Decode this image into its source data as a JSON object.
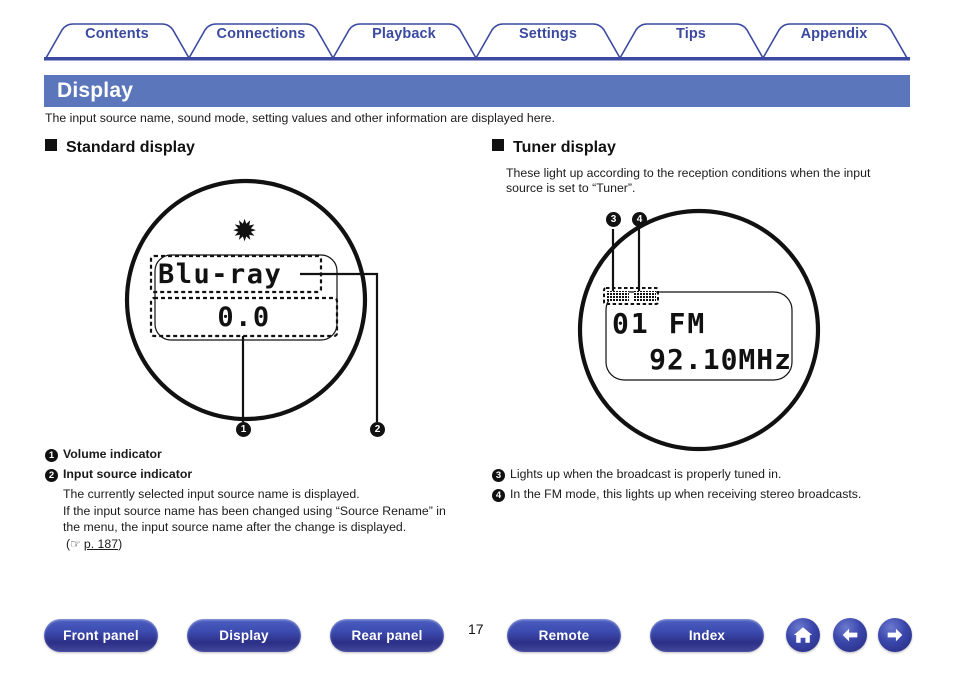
{
  "tabs": [
    {
      "label": "Contents",
      "name": "tab-contents"
    },
    {
      "label": "Connections",
      "name": "tab-connections"
    },
    {
      "label": "Playback",
      "name": "tab-playback"
    },
    {
      "label": "Settings",
      "name": "tab-settings"
    },
    {
      "label": "Tips",
      "name": "tab-tips"
    },
    {
      "label": "Appendix",
      "name": "tab-appendix"
    }
  ],
  "banner": {
    "title": "Display"
  },
  "intro": "The input source name, sound mode, setting values and other information are displayed here.",
  "standard": {
    "heading": "Standard display",
    "screen": {
      "source_text": "Blu-ray",
      "volume_text": "0.0"
    },
    "callouts": [
      {
        "num": "1",
        "title": "Volume indicator",
        "body": []
      },
      {
        "num": "2",
        "title": "Input source indicator",
        "body": [
          "The currently selected input source name is displayed.",
          "If the input source name has been changed using “Source Rename” in",
          "the menu, the input source name after the change is displayed."
        ]
      }
    ],
    "link": {
      "prefix": "(",
      "icon": "pointing-hand-icon",
      "page": "p. 187",
      "suffix": ")"
    },
    "marker_1": "1",
    "marker_2": "2"
  },
  "tuner": {
    "heading": "Tuner display",
    "description_line1": "These light up according to the reception conditions when the input",
    "description_line2": "source is set to “Tuner”.",
    "screen": {
      "preset_band": "01 FM",
      "frequency": "92.10MHz",
      "indicator_tuned": "TUNED",
      "indicator_stereo": "STEREO"
    },
    "marker_3": "3",
    "marker_4": "4",
    "callouts": [
      {
        "num": "3",
        "text": "Lights up when the broadcast is properly tuned in."
      },
      {
        "num": "4",
        "text": "In the FM mode, this lights up when receiving stereo broadcasts."
      }
    ]
  },
  "footer": {
    "page_number": "17",
    "buttons": [
      {
        "label": "Front panel",
        "name": "footer-button-front-panel"
      },
      {
        "label": "Display",
        "name": "footer-button-display"
      },
      {
        "label": "Rear panel",
        "name": "footer-button-rear-panel"
      },
      {
        "label": "Remote",
        "name": "footer-button-remote"
      },
      {
        "label": "Index",
        "name": "footer-button-index"
      }
    ],
    "icons": [
      {
        "name": "home-icon"
      },
      {
        "name": "arrow-left-icon"
      },
      {
        "name": "arrow-right-icon"
      }
    ]
  },
  "colors": {
    "banner_blue": "#5b76ba",
    "tab_text": "#3b4aa0",
    "button_blue": "#3c4bb0"
  }
}
